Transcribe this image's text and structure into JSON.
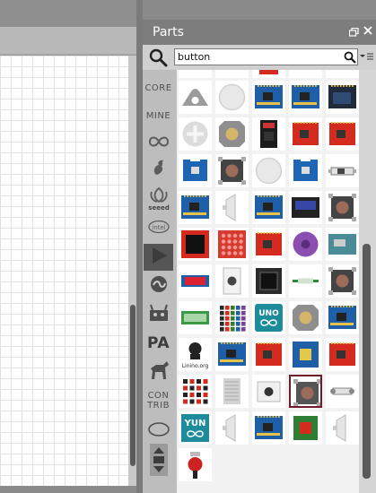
{
  "panel": {
    "title": "Parts"
  },
  "search": {
    "value": "button",
    "placeholder": ""
  },
  "bins": [
    {
      "label": "CORE",
      "kind": "text"
    },
    {
      "label": "MINE",
      "kind": "text"
    },
    {
      "label": "arduino",
      "kind": "icon",
      "icon": "arduino-logo-icon"
    },
    {
      "label": "fritzing",
      "kind": "icon",
      "icon": "fritzing-logo-icon"
    },
    {
      "label": "seeed",
      "kind": "icon",
      "icon": "seeed-logo-icon"
    },
    {
      "label": "intel",
      "kind": "icon",
      "icon": "intel-logo-icon"
    },
    {
      "label": "search",
      "kind": "icon",
      "icon": "search-bin-icon"
    },
    {
      "label": "snootlab",
      "kind": "icon",
      "icon": "snootlab-logo-icon"
    },
    {
      "label": "lilypad",
      "kind": "icon",
      "icon": "robot-icon"
    },
    {
      "label": "PA",
      "kind": "text"
    },
    {
      "label": "animal",
      "kind": "icon",
      "icon": "moose-icon"
    },
    {
      "label": "CON\nTRIB",
      "kind": "text"
    },
    {
      "label": "temp",
      "kind": "icon",
      "icon": "temp-bin-icon"
    },
    {
      "label": "more",
      "kind": "icon",
      "icon": "scroll-arrows-icon"
    }
  ],
  "parts": [
    {
      "kind": "grey-dome"
    },
    {
      "kind": "round-white"
    },
    {
      "kind": "blue-board"
    },
    {
      "kind": "blue-board"
    },
    {
      "kind": "dark-board"
    },
    {
      "kind": "round-cross"
    },
    {
      "kind": "tactile-gold"
    },
    {
      "kind": "black-module"
    },
    {
      "kind": "red-board"
    },
    {
      "kind": "red-board"
    },
    {
      "kind": "blue-small"
    },
    {
      "kind": "tactile-brown"
    },
    {
      "kind": "round-white"
    },
    {
      "kind": "blue-small"
    },
    {
      "kind": "slide-switch"
    },
    {
      "kind": "blue-board"
    },
    {
      "kind": "side-white"
    },
    {
      "kind": "blue-board"
    },
    {
      "kind": "lcd"
    },
    {
      "kind": "tactile-brown"
    },
    {
      "kind": "red-square"
    },
    {
      "kind": "red-grid"
    },
    {
      "kind": "red-board"
    },
    {
      "kind": "purple-round"
    },
    {
      "kind": "teal-module"
    },
    {
      "kind": "blue-display"
    },
    {
      "kind": "white-module"
    },
    {
      "kind": "big-black-button"
    },
    {
      "kind": "green-wire"
    },
    {
      "kind": "tactile-brown"
    },
    {
      "kind": "green-lcd"
    },
    {
      "kind": "led-grid"
    },
    {
      "kind": "uno-logo"
    },
    {
      "kind": "tactile-gold"
    },
    {
      "kind": "blue-board"
    },
    {
      "kind": "linino"
    },
    {
      "kind": "blue-board"
    },
    {
      "kind": "red-board"
    },
    {
      "kind": "blue-yellow"
    },
    {
      "kind": "red-board"
    },
    {
      "kind": "red-matrix"
    },
    {
      "kind": "grey-slot"
    },
    {
      "kind": "white-button"
    },
    {
      "kind": "tactile-brown-sel"
    },
    {
      "kind": "gear-switch"
    },
    {
      "kind": "yun-logo"
    },
    {
      "kind": "side-white"
    },
    {
      "kind": "blue-board"
    },
    {
      "kind": "green-red"
    },
    {
      "kind": "side-white"
    },
    {
      "kind": "red-knob"
    }
  ],
  "parts_labels": {
    "uno": "UNO",
    "yun": "YUN",
    "linino": "Linino.org"
  },
  "colors": {
    "selected_border": "#6e1b2b",
    "accent_blue": "#1f6fb2"
  }
}
